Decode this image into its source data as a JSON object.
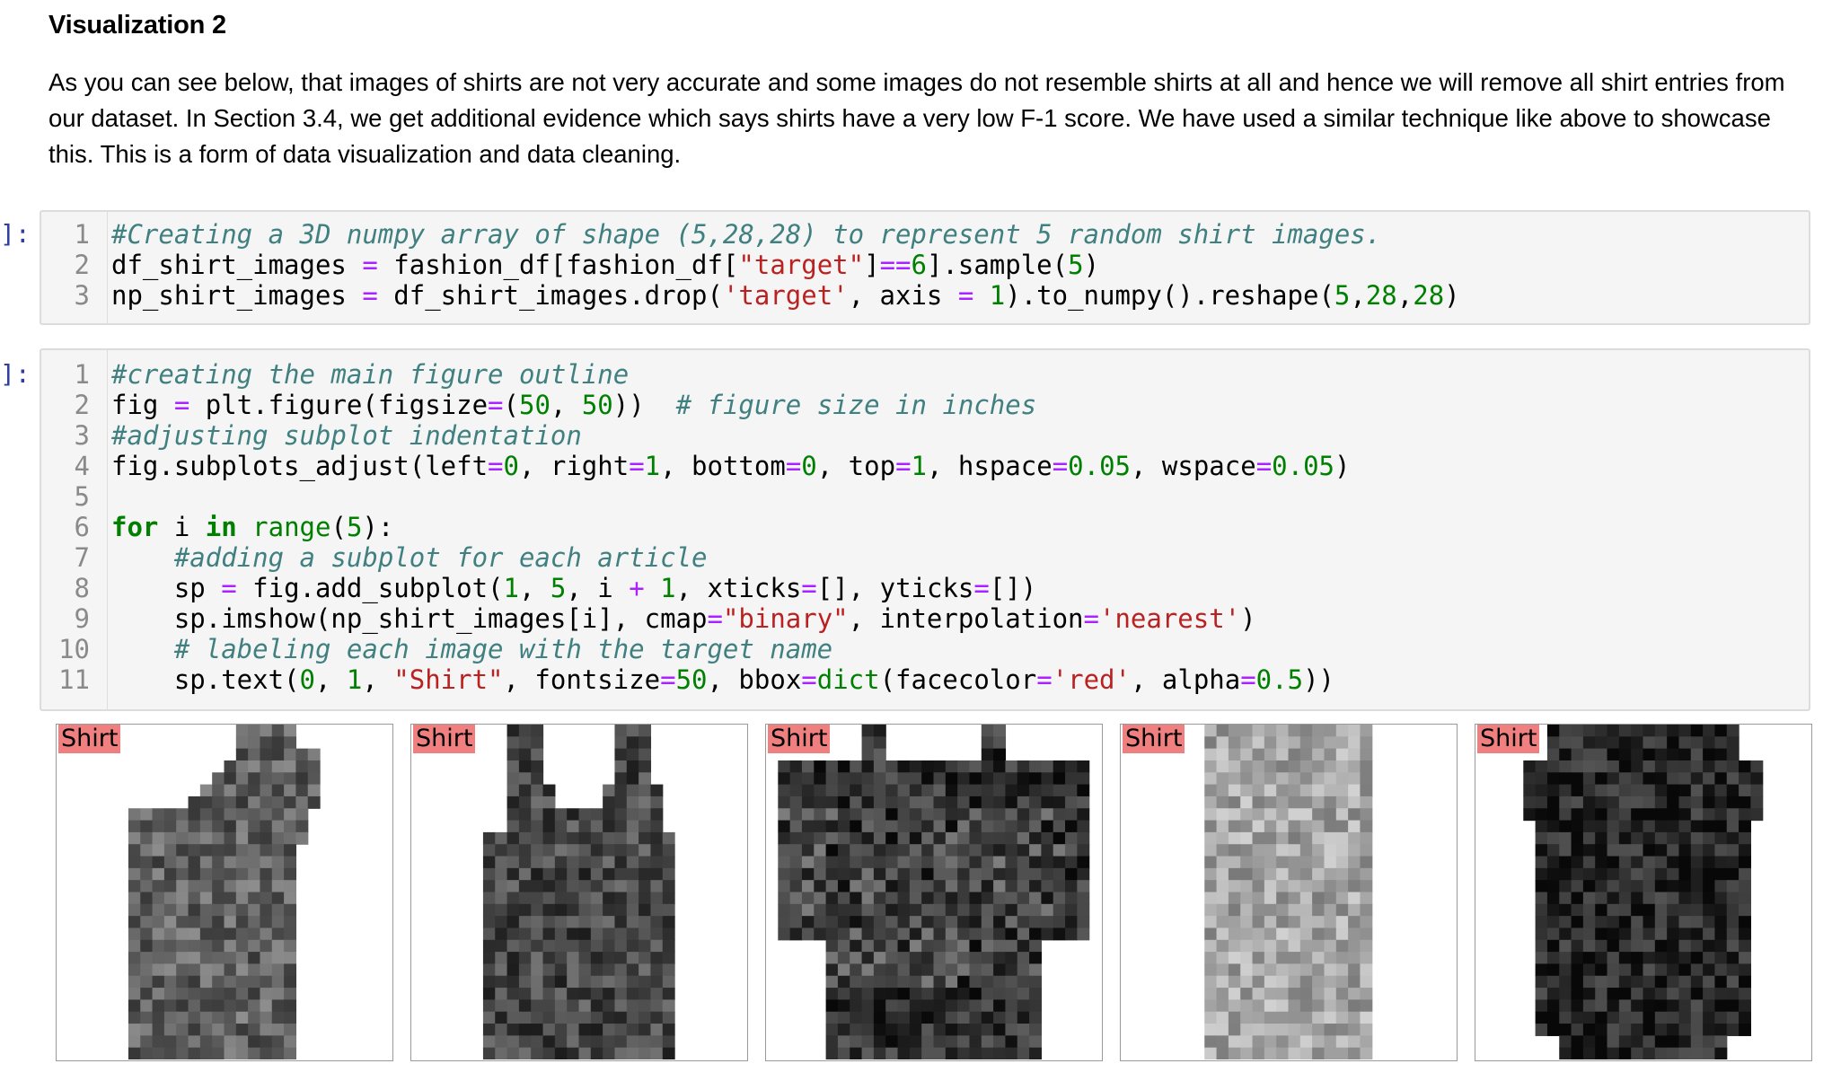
{
  "heading": "Visualization 2",
  "paragraph": "As you can see below, that images of shirts are not very accurate and some images do not resemble shirts at all and hence we will remove all shirt entries from our dataset. In Section 3.4, we get additional evidence which says shirts have a very low F-1 score. We have used a similar technique like above to showcase this. This is a form of data visualization and data cleaning.",
  "prompt_label": "]:",
  "cell1": {
    "line_numbers": [
      "1",
      "2",
      "3"
    ]
  },
  "cell2": {
    "line_numbers": [
      "1",
      "2",
      "3",
      "4",
      "5",
      "6",
      "7",
      "8",
      "9",
      "10",
      "11"
    ]
  },
  "output": {
    "image_label": "Shirt",
    "images": [
      {
        "name": "shirt-image-1",
        "shade": 0.62
      },
      {
        "name": "shirt-image-2",
        "shade": 0.72
      },
      {
        "name": "shirt-image-3",
        "shade": 0.8
      },
      {
        "name": "shirt-image-4",
        "shade": 0.35
      },
      {
        "name": "shirt-image-5",
        "shade": 0.85
      }
    ]
  }
}
